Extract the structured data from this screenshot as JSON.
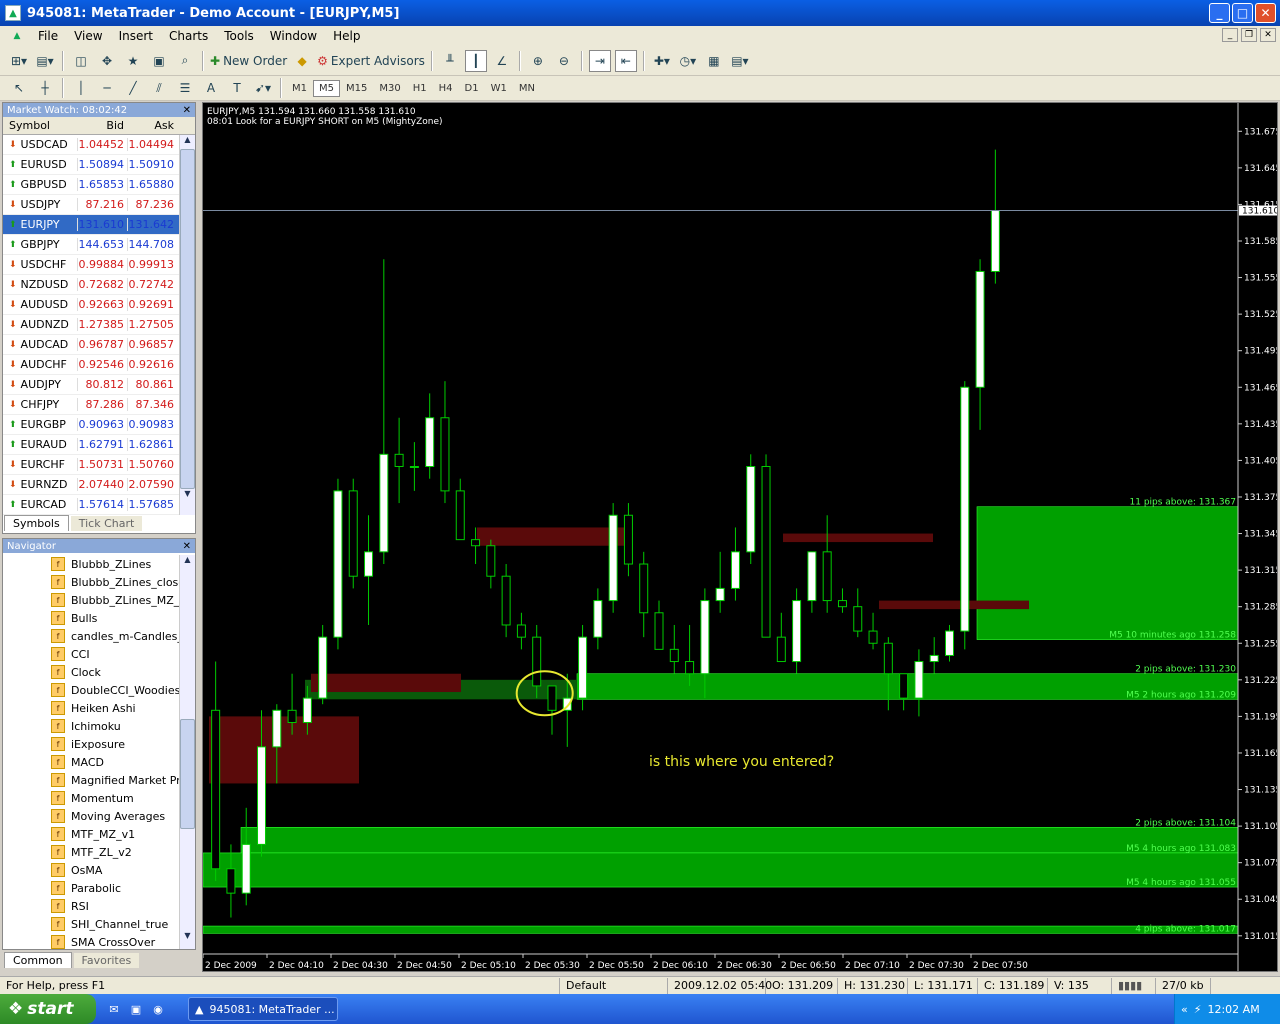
{
  "window": {
    "title": "945081: MetaTrader - Demo Account - [EURJPY,M5]"
  },
  "menu": [
    "File",
    "View",
    "Insert",
    "Charts",
    "Tools",
    "Window",
    "Help"
  ],
  "toolbar": {
    "new_order": "New Order",
    "expert_advisors": "Expert Advisors"
  },
  "timeframes": [
    "M1",
    "M5",
    "M15",
    "M30",
    "H1",
    "H4",
    "D1",
    "W1",
    "MN"
  ],
  "active_timeframe": "M5",
  "market_watch": {
    "title": "Market Watch: 08:02:42",
    "headers": {
      "symbol": "Symbol",
      "bid": "Bid",
      "ask": "Ask"
    },
    "rows": [
      {
        "symbol": "USDCAD",
        "bid": "1.04452",
        "ask": "1.04494",
        "dir": "down"
      },
      {
        "symbol": "EURUSD",
        "bid": "1.50894",
        "ask": "1.50910",
        "dir": "up"
      },
      {
        "symbol": "GBPUSD",
        "bid": "1.65853",
        "ask": "1.65880",
        "dir": "up"
      },
      {
        "symbol": "USDJPY",
        "bid": "87.216",
        "ask": "87.236",
        "dir": "down"
      },
      {
        "symbol": "EURJPY",
        "bid": "131.610",
        "ask": "131.642",
        "dir": "up",
        "selected": true
      },
      {
        "symbol": "GBPJPY",
        "bid": "144.653",
        "ask": "144.708",
        "dir": "up"
      },
      {
        "symbol": "USDCHF",
        "bid": "0.99884",
        "ask": "0.99913",
        "dir": "down"
      },
      {
        "symbol": "NZDUSD",
        "bid": "0.72682",
        "ask": "0.72742",
        "dir": "down"
      },
      {
        "symbol": "AUDUSD",
        "bid": "0.92663",
        "ask": "0.92691",
        "dir": "down"
      },
      {
        "symbol": "AUDNZD",
        "bid": "1.27385",
        "ask": "1.27505",
        "dir": "down"
      },
      {
        "symbol": "AUDCAD",
        "bid": "0.96787",
        "ask": "0.96857",
        "dir": "down"
      },
      {
        "symbol": "AUDCHF",
        "bid": "0.92546",
        "ask": "0.92616",
        "dir": "down"
      },
      {
        "symbol": "AUDJPY",
        "bid": "80.812",
        "ask": "80.861",
        "dir": "down"
      },
      {
        "symbol": "CHFJPY",
        "bid": "87.286",
        "ask": "87.346",
        "dir": "down"
      },
      {
        "symbol": "EURGBP",
        "bid": "0.90963",
        "ask": "0.90983",
        "dir": "up"
      },
      {
        "symbol": "EURAUD",
        "bid": "1.62791",
        "ask": "1.62861",
        "dir": "up"
      },
      {
        "symbol": "EURCHF",
        "bid": "1.50731",
        "ask": "1.50760",
        "dir": "down"
      },
      {
        "symbol": "EURNZD",
        "bid": "2.07440",
        "ask": "2.07590",
        "dir": "down"
      },
      {
        "symbol": "EURCAD",
        "bid": "1.57614",
        "ask": "1.57685",
        "dir": "up"
      }
    ],
    "tabs": [
      "Symbols",
      "Tick Chart"
    ]
  },
  "navigator": {
    "title": "Navigator",
    "items": [
      "Blubbb_ZLines",
      "Blubbb_ZLines_close_",
      "Blubbb_ZLines_MZ_re",
      "Bulls",
      "candles_m-Candles_m",
      "CCI",
      "Clock",
      "DoubleCCI_Woodies",
      "Heiken Ashi",
      "Ichimoku",
      "iExposure",
      "MACD",
      "Magnified Market Price",
      "Momentum",
      "Moving Averages",
      "MTF_MZ_v1",
      "MTF_ZL_v2",
      "OsMA",
      "Parabolic",
      "RSI",
      "SHI_Channel_true",
      "SMA CrossOver"
    ],
    "tabs": [
      "Common",
      "Favorites"
    ]
  },
  "chart": {
    "info_line1": "EURJPY,M5  131.594 131.660 131.558 131.610",
    "info_line2": "08:01 Look for a EURJPY SHORT on M5 (MightyZone)",
    "annotation": "is this where you entered?",
    "current_price": "131.610",
    "price_labels": [
      "131.675",
      "131.645",
      "131.615",
      "131.585",
      "131.555",
      "131.525",
      "131.495",
      "131.465",
      "131.435",
      "131.405",
      "131.375",
      "131.345",
      "131.315",
      "131.285",
      "131.255",
      "131.225",
      "131.195",
      "131.165",
      "131.135",
      "131.105",
      "131.075",
      "131.045",
      "131.015"
    ],
    "time_labels": [
      "2 Dec 2009",
      "2 Dec 04:10",
      "2 Dec 04:30",
      "2 Dec 04:50",
      "2 Dec 05:10",
      "2 Dec 05:30",
      "2 Dec 05:50",
      "2 Dec 06:10",
      "2 Dec 06:30",
      "2 Dec 06:50",
      "2 Dec 07:10",
      "2 Dec 07:30",
      "2 Dec 07:50"
    ],
    "zone_labels": [
      "11 pips above: 131.367",
      "M5 10 minutes ago 131.258",
      "2 pips above: 131.230",
      "M5 2 hours ago 131.209",
      "2 pips above: 131.104",
      "M5 4 hours ago 131.083",
      "M5 4 hours ago 131.055",
      "4 pips above: 131.017"
    ],
    "colors": {
      "bull": "#ffffff",
      "bear": "#000000",
      "wick": "#00cc00",
      "zone": "#00a000",
      "zone_red": "#5a0a0a",
      "annotation": "#e8e830"
    }
  },
  "chart_data": {
    "type": "candlestick",
    "x_labels": [
      "2 Dec 2009",
      "2 Dec 04:10",
      "2 Dec 04:30",
      "2 Dec 04:50",
      "2 Dec 05:10",
      "2 Dec 05:30",
      "2 Dec 05:50",
      "2 Dec 06:10",
      "2 Dec 06:30",
      "2 Dec 06:50",
      "2 Dec 07:10",
      "2 Dec 07:30",
      "2 Dec 07:50"
    ],
    "ylim": [
      131.005,
      131.69
    ],
    "candles": [
      [
        131.2,
        131.24,
        131.06,
        131.07
      ],
      [
        131.07,
        131.09,
        131.03,
        131.05
      ],
      [
        131.05,
        131.12,
        131.04,
        131.09
      ],
      [
        131.09,
        131.2,
        131.08,
        131.17
      ],
      [
        131.17,
        131.205,
        131.14,
        131.2
      ],
      [
        131.2,
        131.23,
        131.18,
        131.19
      ],
      [
        131.19,
        131.22,
        131.18,
        131.21
      ],
      [
        131.21,
        131.27,
        131.205,
        131.26
      ],
      [
        131.26,
        131.39,
        131.25,
        131.38
      ],
      [
        131.38,
        131.39,
        131.3,
        131.31
      ],
      [
        131.31,
        131.36,
        131.27,
        131.33
      ],
      [
        131.33,
        131.57,
        131.32,
        131.41
      ],
      [
        131.41,
        131.44,
        131.37,
        131.4
      ],
      [
        131.4,
        131.42,
        131.38,
        131.4
      ],
      [
        131.4,
        131.46,
        131.39,
        131.44
      ],
      [
        131.44,
        131.47,
        131.37,
        131.38
      ],
      [
        131.38,
        131.39,
        131.34,
        131.34
      ],
      [
        131.34,
        131.35,
        131.32,
        131.335
      ],
      [
        131.335,
        131.34,
        131.3,
        131.31
      ],
      [
        131.31,
        131.32,
        131.26,
        131.27
      ],
      [
        131.27,
        131.28,
        131.25,
        131.26
      ],
      [
        131.26,
        131.27,
        131.21,
        131.22
      ],
      [
        131.22,
        131.22,
        131.18,
        131.2
      ],
      [
        131.2,
        131.23,
        131.17,
        131.21
      ],
      [
        131.21,
        131.27,
        131.2,
        131.26
      ],
      [
        131.26,
        131.3,
        131.25,
        131.29
      ],
      [
        131.29,
        131.37,
        131.28,
        131.36
      ],
      [
        131.36,
        131.37,
        131.31,
        131.32
      ],
      [
        131.32,
        131.33,
        131.26,
        131.28
      ],
      [
        131.28,
        131.29,
        131.25,
        131.25
      ],
      [
        131.25,
        131.27,
        131.23,
        131.24
      ],
      [
        131.24,
        131.27,
        131.22,
        131.23
      ],
      [
        131.23,
        131.3,
        131.21,
        131.29
      ],
      [
        131.29,
        131.33,
        131.28,
        131.3
      ],
      [
        131.3,
        131.35,
        131.29,
        131.33
      ],
      [
        131.33,
        131.41,
        131.32,
        131.4
      ],
      [
        131.4,
        131.41,
        131.26,
        131.26
      ],
      [
        131.26,
        131.28,
        131.24,
        131.24
      ],
      [
        131.24,
        131.3,
        131.23,
        131.29
      ],
      [
        131.29,
        131.33,
        131.28,
        131.33
      ],
      [
        131.33,
        131.36,
        131.28,
        131.29
      ],
      [
        131.29,
        131.3,
        131.28,
        131.285
      ],
      [
        131.285,
        131.3,
        131.26,
        131.265
      ],
      [
        131.265,
        131.28,
        131.25,
        131.255
      ],
      [
        131.255,
        131.26,
        131.2,
        131.23
      ],
      [
        131.23,
        131.23,
        131.2,
        131.21
      ],
      [
        131.21,
        131.25,
        131.195,
        131.24
      ],
      [
        131.24,
        131.26,
        131.23,
        131.245
      ],
      [
        131.245,
        131.27,
        131.24,
        131.265
      ],
      [
        131.265,
        131.47,
        131.25,
        131.465
      ],
      [
        131.465,
        131.57,
        131.43,
        131.56
      ],
      [
        131.56,
        131.66,
        131.55,
        131.61
      ]
    ],
    "current_price": 131.61
  }
}
